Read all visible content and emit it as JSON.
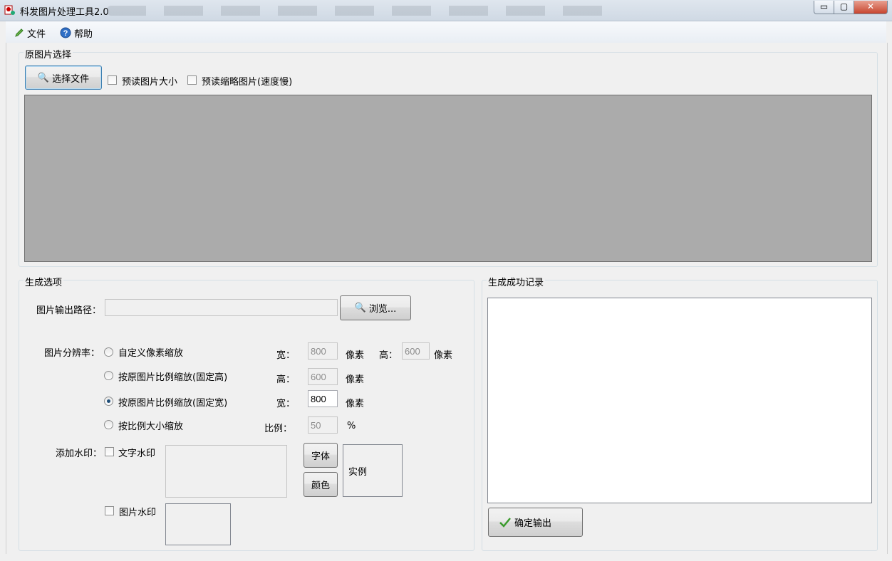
{
  "window": {
    "title": "科发图片处理工具2.0",
    "controls": {
      "minimize": "▭",
      "maximize": "▢",
      "close": "✕"
    }
  },
  "menu": {
    "file": {
      "label": "文件",
      "icon": "pencil-icon"
    },
    "help": {
      "label": "帮助",
      "icon": "help-icon"
    }
  },
  "source": {
    "group_label": "原图片选择",
    "select_button": "选择文件",
    "preload_size": {
      "label": "预读图片大小",
      "checked": false
    },
    "preload_thumbs": {
      "label": "预读缩略图片(速度慢)",
      "checked": false
    },
    "preview_bg": "#ababab"
  },
  "options": {
    "group_label": "生成选项",
    "output_path": {
      "label": "图片输出路径：",
      "value": "",
      "browse_button": "浏览..."
    },
    "resolution": {
      "label": "图片分辨率：",
      "modes": [
        {
          "label": "自定义像素缩放",
          "selected": false
        },
        {
          "label": "按原图片比例缩放(固定高)",
          "selected": false
        },
        {
          "label": "按原图片比例缩放(固定宽)",
          "selected": true
        },
        {
          "label": "按比例大小缩放",
          "selected": false
        }
      ],
      "custom": {
        "width_label": "宽：",
        "width": "800",
        "width_unit": "像素",
        "height_label": "高：",
        "height": "600",
        "height_unit": "像素"
      },
      "fixed_height": {
        "label": "高：",
        "value": "600",
        "unit": "像素"
      },
      "fixed_width": {
        "label": "宽：",
        "value": "800",
        "unit": "像素"
      },
      "ratio": {
        "label": "比例：",
        "value": "50",
        "unit": "%"
      }
    },
    "watermark": {
      "label": "添加水印：",
      "text": {
        "label": "文字水印",
        "checked": false
      },
      "font_button": "字体",
      "color_button": "颜色",
      "sample": "实例",
      "image": {
        "label": "图片水印",
        "checked": false
      }
    }
  },
  "log": {
    "group_label": "生成成功记录",
    "confirm_button": "确定输出"
  }
}
